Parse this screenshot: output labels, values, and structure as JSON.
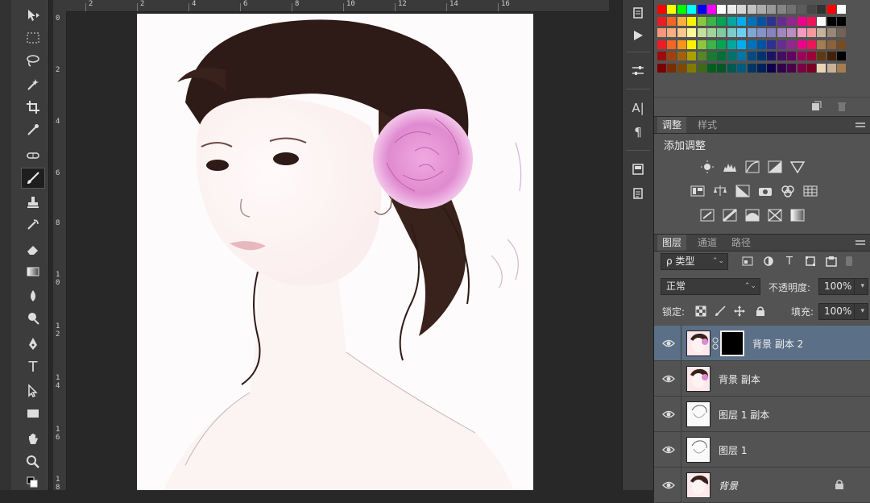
{
  "toolbar": {
    "tools": [
      {
        "name": "move",
        "icon": "move-icon"
      },
      {
        "name": "marquee",
        "icon": "rect-marquee-icon"
      },
      {
        "name": "lasso",
        "icon": "lasso-icon"
      },
      {
        "name": "quick-select",
        "icon": "magic-wand-icon"
      },
      {
        "name": "crop",
        "icon": "crop-icon"
      },
      {
        "name": "eyedropper",
        "icon": "eyedropper-icon"
      },
      {
        "name": "healing",
        "icon": "healing-brush-icon"
      },
      {
        "name": "brush",
        "icon": "brush-icon"
      },
      {
        "name": "stamp",
        "icon": "clone-stamp-icon"
      },
      {
        "name": "history-brush",
        "icon": "history-brush-icon"
      },
      {
        "name": "eraser",
        "icon": "eraser-icon"
      },
      {
        "name": "gradient",
        "icon": "gradient-icon"
      },
      {
        "name": "blur",
        "icon": "blur-icon"
      },
      {
        "name": "dodge",
        "icon": "dodge-icon"
      },
      {
        "name": "pen",
        "icon": "pen-icon"
      },
      {
        "name": "type",
        "icon": "type-icon",
        "label": "T"
      },
      {
        "name": "path-select",
        "icon": "path-select-icon"
      },
      {
        "name": "shape",
        "icon": "rectangle-icon"
      },
      {
        "name": "hand",
        "icon": "hand-icon"
      },
      {
        "name": "zoom",
        "icon": "zoom-icon"
      }
    ]
  },
  "rulers": {
    "top": [
      "0",
      "2",
      "4",
      "6",
      "8",
      "10",
      "12",
      "14",
      "16"
    ],
    "left": [
      "0",
      "2",
      "4",
      "6",
      "8",
      "10",
      "12",
      "14",
      "16",
      "18"
    ]
  },
  "mid_strip": {
    "type_label": "A|",
    "para_label": "¶"
  },
  "adjustments_panel": {
    "tabs": [
      "调整",
      "样式"
    ],
    "title": "添加调整"
  },
  "layers_panel": {
    "tabs": [
      "图层",
      "通道",
      "路径"
    ],
    "filter_label": "ρ 类型",
    "blend_mode": "正常",
    "opacity_label": "不透明度:",
    "opacity_value": "100%",
    "lock_label": "锁定:",
    "fill_label": "填充:",
    "fill_value": "100%",
    "layers": [
      {
        "name": "背景 副本 2",
        "selected": true,
        "has_mask": true
      },
      {
        "name": "背景 副本",
        "selected": false,
        "has_mask": false
      },
      {
        "name": "图层 1 副本",
        "selected": false,
        "has_mask": false
      },
      {
        "name": "图层 1",
        "selected": false,
        "has_mask": false
      },
      {
        "name": "背景",
        "selected": false,
        "has_mask": false,
        "locked": true,
        "italic": true
      }
    ]
  },
  "colors": {
    "panel_bg": "#535353",
    "selected_layer": "#5b6f87",
    "workspace": "#282828"
  }
}
